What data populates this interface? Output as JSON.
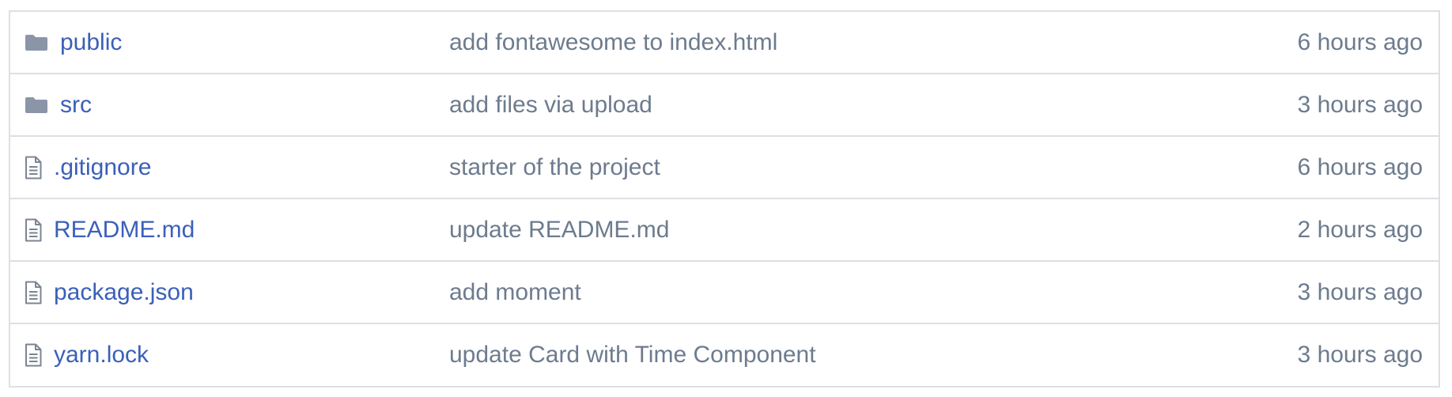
{
  "colors": {
    "link": "#3b60b8",
    "muted_text": "#6d7b8e",
    "folder_icon": "#8a95a8",
    "file_icon": "#7b8592",
    "border": "#dcdfe3"
  },
  "files": [
    {
      "type": "folder",
      "icon": "folder-icon",
      "name": "public",
      "message": "add fontawesome to index.html",
      "age": "6 hours ago"
    },
    {
      "type": "folder",
      "icon": "folder-icon",
      "name": "src",
      "message": "add files via upload",
      "age": "3 hours ago"
    },
    {
      "type": "file",
      "icon": "file-icon",
      "name": ".gitignore",
      "message": "starter of the project",
      "age": "6 hours ago"
    },
    {
      "type": "file",
      "icon": "file-icon",
      "name": "README.md",
      "message": "update README.md",
      "age": "2 hours ago"
    },
    {
      "type": "file",
      "icon": "file-icon",
      "name": "package.json",
      "message": "add moment",
      "age": "3 hours ago"
    },
    {
      "type": "file",
      "icon": "file-icon",
      "name": "yarn.lock",
      "message": "update Card with Time Component",
      "age": "3 hours ago"
    }
  ]
}
